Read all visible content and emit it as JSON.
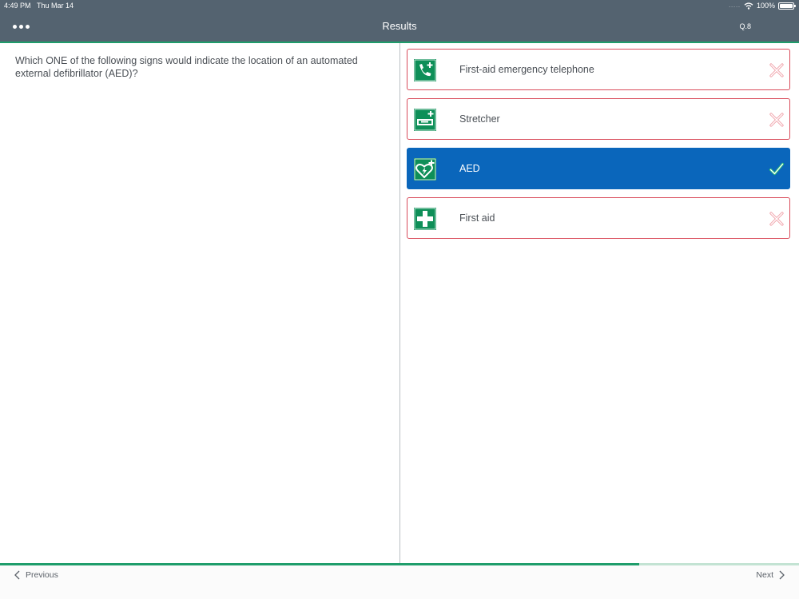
{
  "status_bar": {
    "time": "4:49 PM",
    "date": "Thu Mar 14",
    "signal": ".....",
    "battery": "100%",
    "icons": [
      "wifi-icon",
      "battery-icon"
    ]
  },
  "header": {
    "menu_icon": "more-dots-icon",
    "title": "Results",
    "question_number": "Q.8"
  },
  "question": {
    "text": "Which ONE of the following signs would indicate the location of an automated external defibrillator (AED)?"
  },
  "answers": [
    {
      "label": "First-aid emergency telephone",
      "icon": "emergency-telephone-sign-icon",
      "selected": false,
      "result": "incorrect"
    },
    {
      "label": "Stretcher",
      "icon": "stretcher-sign-icon",
      "selected": false,
      "result": "incorrect"
    },
    {
      "label": "AED",
      "icon": "aed-sign-icon",
      "selected": true,
      "result": "correct"
    },
    {
      "label": "First aid",
      "icon": "first-aid-sign-icon",
      "selected": false,
      "result": "incorrect"
    }
  ],
  "navigation": {
    "previous_label": "Previous",
    "next_label": "Next"
  },
  "progress": {
    "fraction": 0.8
  },
  "colors": {
    "header": "#546370",
    "accent_green": "#1f9d6b",
    "sign_green": "#0e8f58",
    "selected_blue": "#0a66bb",
    "incorrect_red": "#d94b5a"
  }
}
